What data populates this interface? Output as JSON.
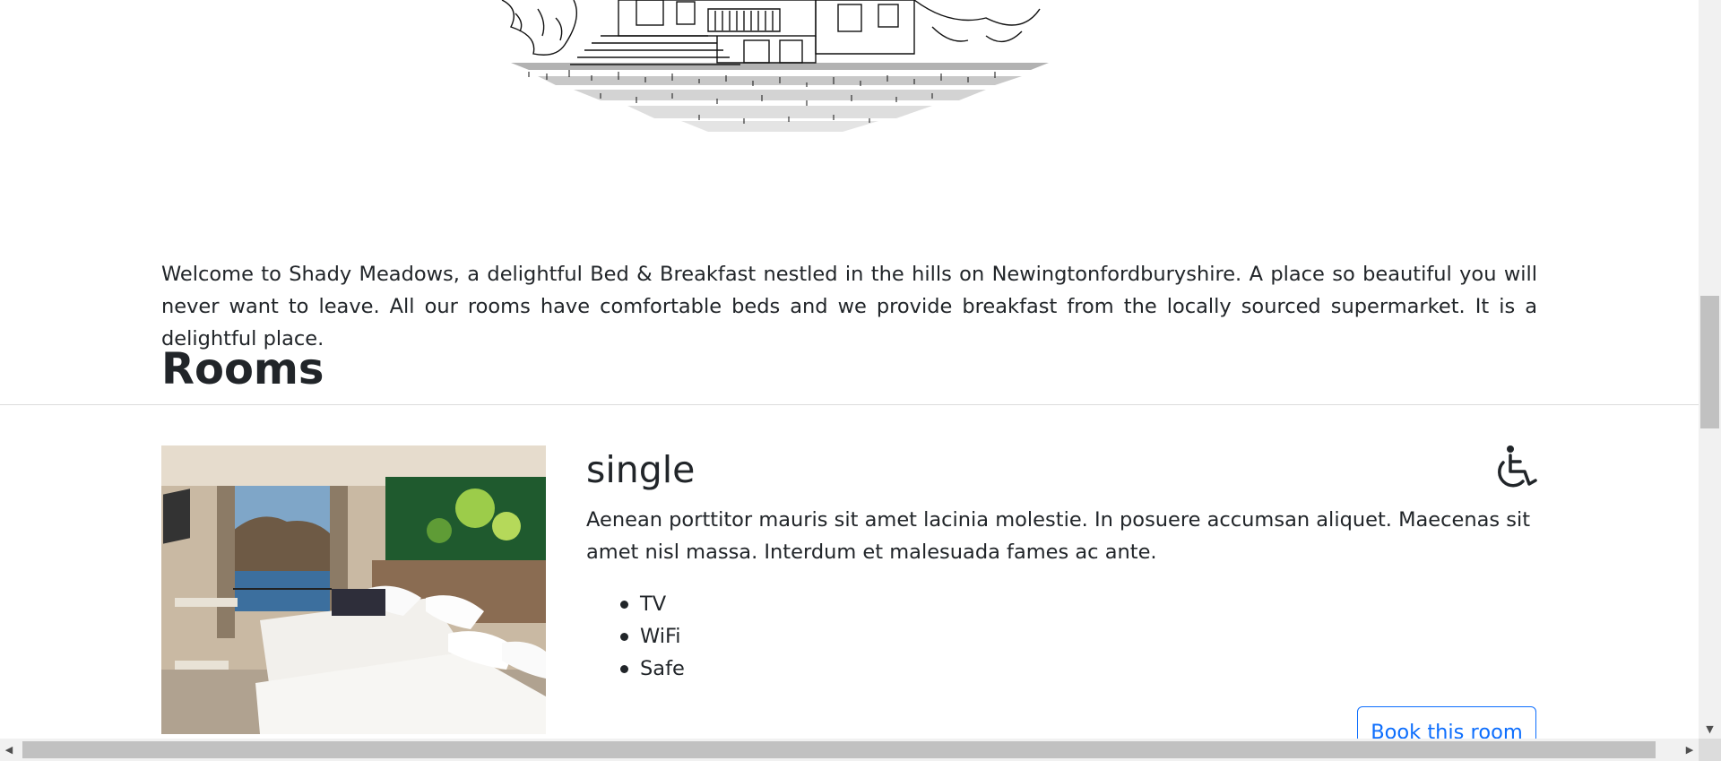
{
  "intro": {
    "welcome_text": "Welcome to Shady Meadows, a delightful Bed & Breakfast nestled in the hills on Newingtonfordburyshire. A place so beautiful you will never want to leave. All our rooms have comfortable beds and we provide breakfast from the locally sourced supermarket. It is a delightful place."
  },
  "rooms_section": {
    "title": "Rooms",
    "rooms": [
      {
        "name": "single",
        "description": "Aenean porttitor mauris sit amet lacinia molestie. In posuere accumsan aliquet. Maecenas sit amet nisl massa. Interdum et malesuada fames ac ante.",
        "features": [
          "TV",
          "WiFi",
          "Safe"
        ],
        "book_label": "Book this room",
        "accessible_icon": "wheelchair-icon"
      }
    ]
  },
  "colors": {
    "text": "#212529",
    "link_blue": "#0d6efd"
  }
}
